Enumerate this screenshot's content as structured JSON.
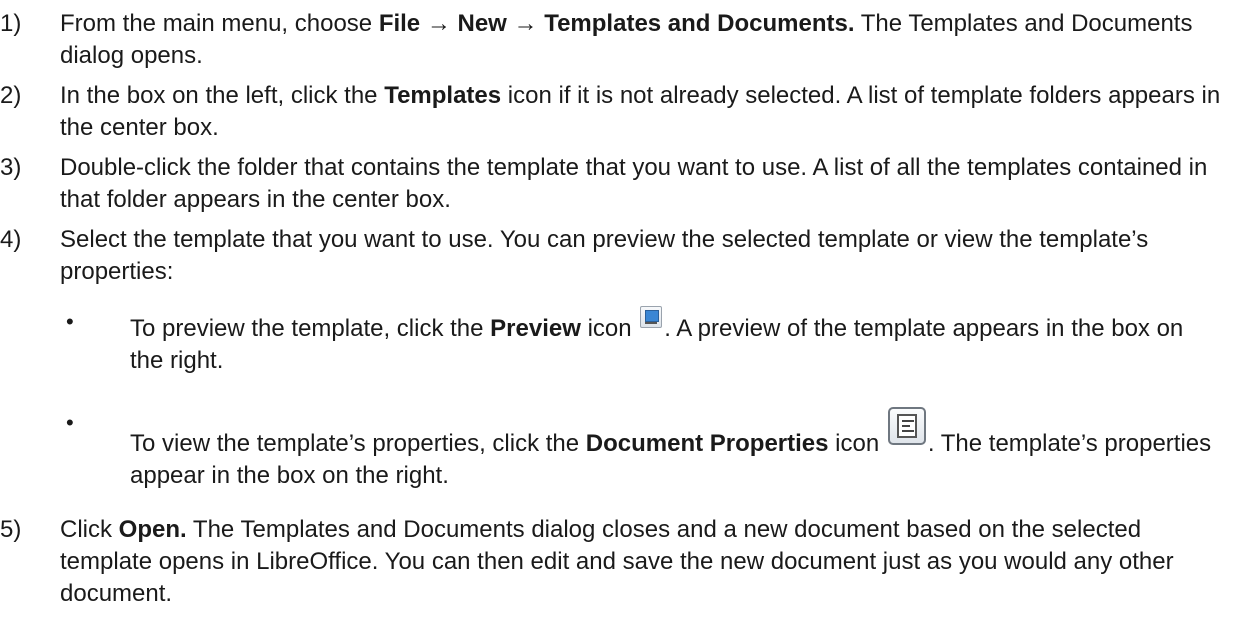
{
  "steps": [
    {
      "num": "1)",
      "parts": [
        {
          "t": "From the main menu, choose "
        },
        {
          "t": "File",
          "b": true
        },
        {
          "t": " → "
        },
        {
          "t": "New",
          "b": true
        },
        {
          "t": " → "
        },
        {
          "t": "Templates and Documents.",
          "b": true
        },
        {
          "t": " The Templates and Documents dialog opens."
        }
      ]
    },
    {
      "num": "2)",
      "parts": [
        {
          "t": "In the box on the left, click the "
        },
        {
          "t": "Templates",
          "b": true
        },
        {
          "t": " icon if it is not already selected. A list of template folders appears in the center box."
        }
      ]
    },
    {
      "num": "3)",
      "parts": [
        {
          "t": "Double-click the folder that contains the template that you want to use. A list of all the templates contained in that folder appears in the center box."
        }
      ]
    },
    {
      "num": "4)",
      "parts": [
        {
          "t": "Select the template that you want to use. You can preview the selected template or view the template’s properties:"
        }
      ]
    },
    {
      "num": "5)",
      "parts": [
        {
          "t": "Click "
        },
        {
          "t": "Open.",
          "b": true
        },
        {
          "t": " The Templates and Documents dialog closes and a new document based on the selected template opens in LibreOffice. You can then edit and save the new document just as you would any other document."
        }
      ]
    }
  ],
  "bullets": [
    {
      "dot": "•",
      "before": "To preview the template, click the ",
      "bold": "Preview",
      "mid": " icon",
      "after": ". A preview of the template appears in the box on the right.",
      "icon": "preview-icon"
    },
    {
      "dot": "•",
      "before": "To view the template’s properties, click the ",
      "bold": "Document Properties",
      "mid": " icon",
      "after": ". The template’s properties appear in the box on the right.",
      "icon": "document-properties-icon"
    }
  ]
}
